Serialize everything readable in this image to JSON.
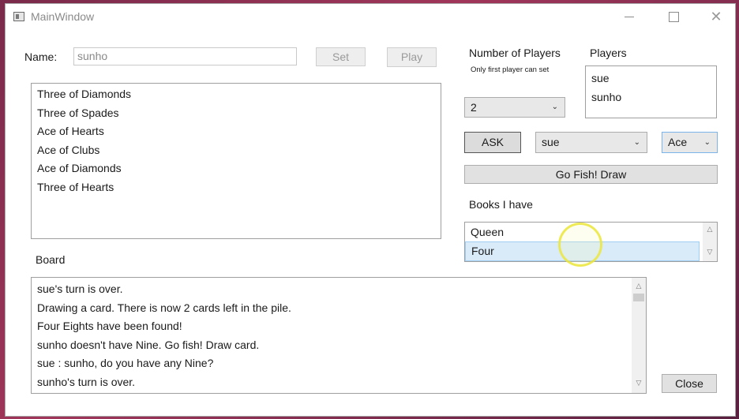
{
  "window": {
    "title": "MainWindow"
  },
  "player": {
    "name_label": "Name:",
    "name_value": "sunho",
    "set_label": "Set",
    "play_label": "Play"
  },
  "hand": [
    "Three of Diamonds",
    "Three of Spades",
    "Ace of Hearts",
    "Ace of Clubs",
    "Ace of Diamonds",
    "Three of Hearts"
  ],
  "settings": {
    "num_players_label": "Number of Players",
    "num_players_note": "Only first player can set",
    "num_players_value": "2",
    "players_label": "Players",
    "players": [
      "sue",
      "sunho"
    ]
  },
  "actions": {
    "ask_label": "ASK",
    "target_player": "sue",
    "target_rank": "Ace",
    "gofish_label": "Go Fish! Draw"
  },
  "books": {
    "label": "Books I have",
    "items": [
      "Queen",
      "Four"
    ]
  },
  "board": {
    "label": "Board",
    "lines": [
      "sue's turn is over.",
      "Drawing a card. There is now 2 cards left in the pile.",
      "Four Eights have been found!",
      "sunho doesn't have Nine. Go fish! Draw card.",
      "sue : sunho, do you have any Nine?",
      "sunho's turn is over."
    ]
  },
  "close_label": "Close"
}
